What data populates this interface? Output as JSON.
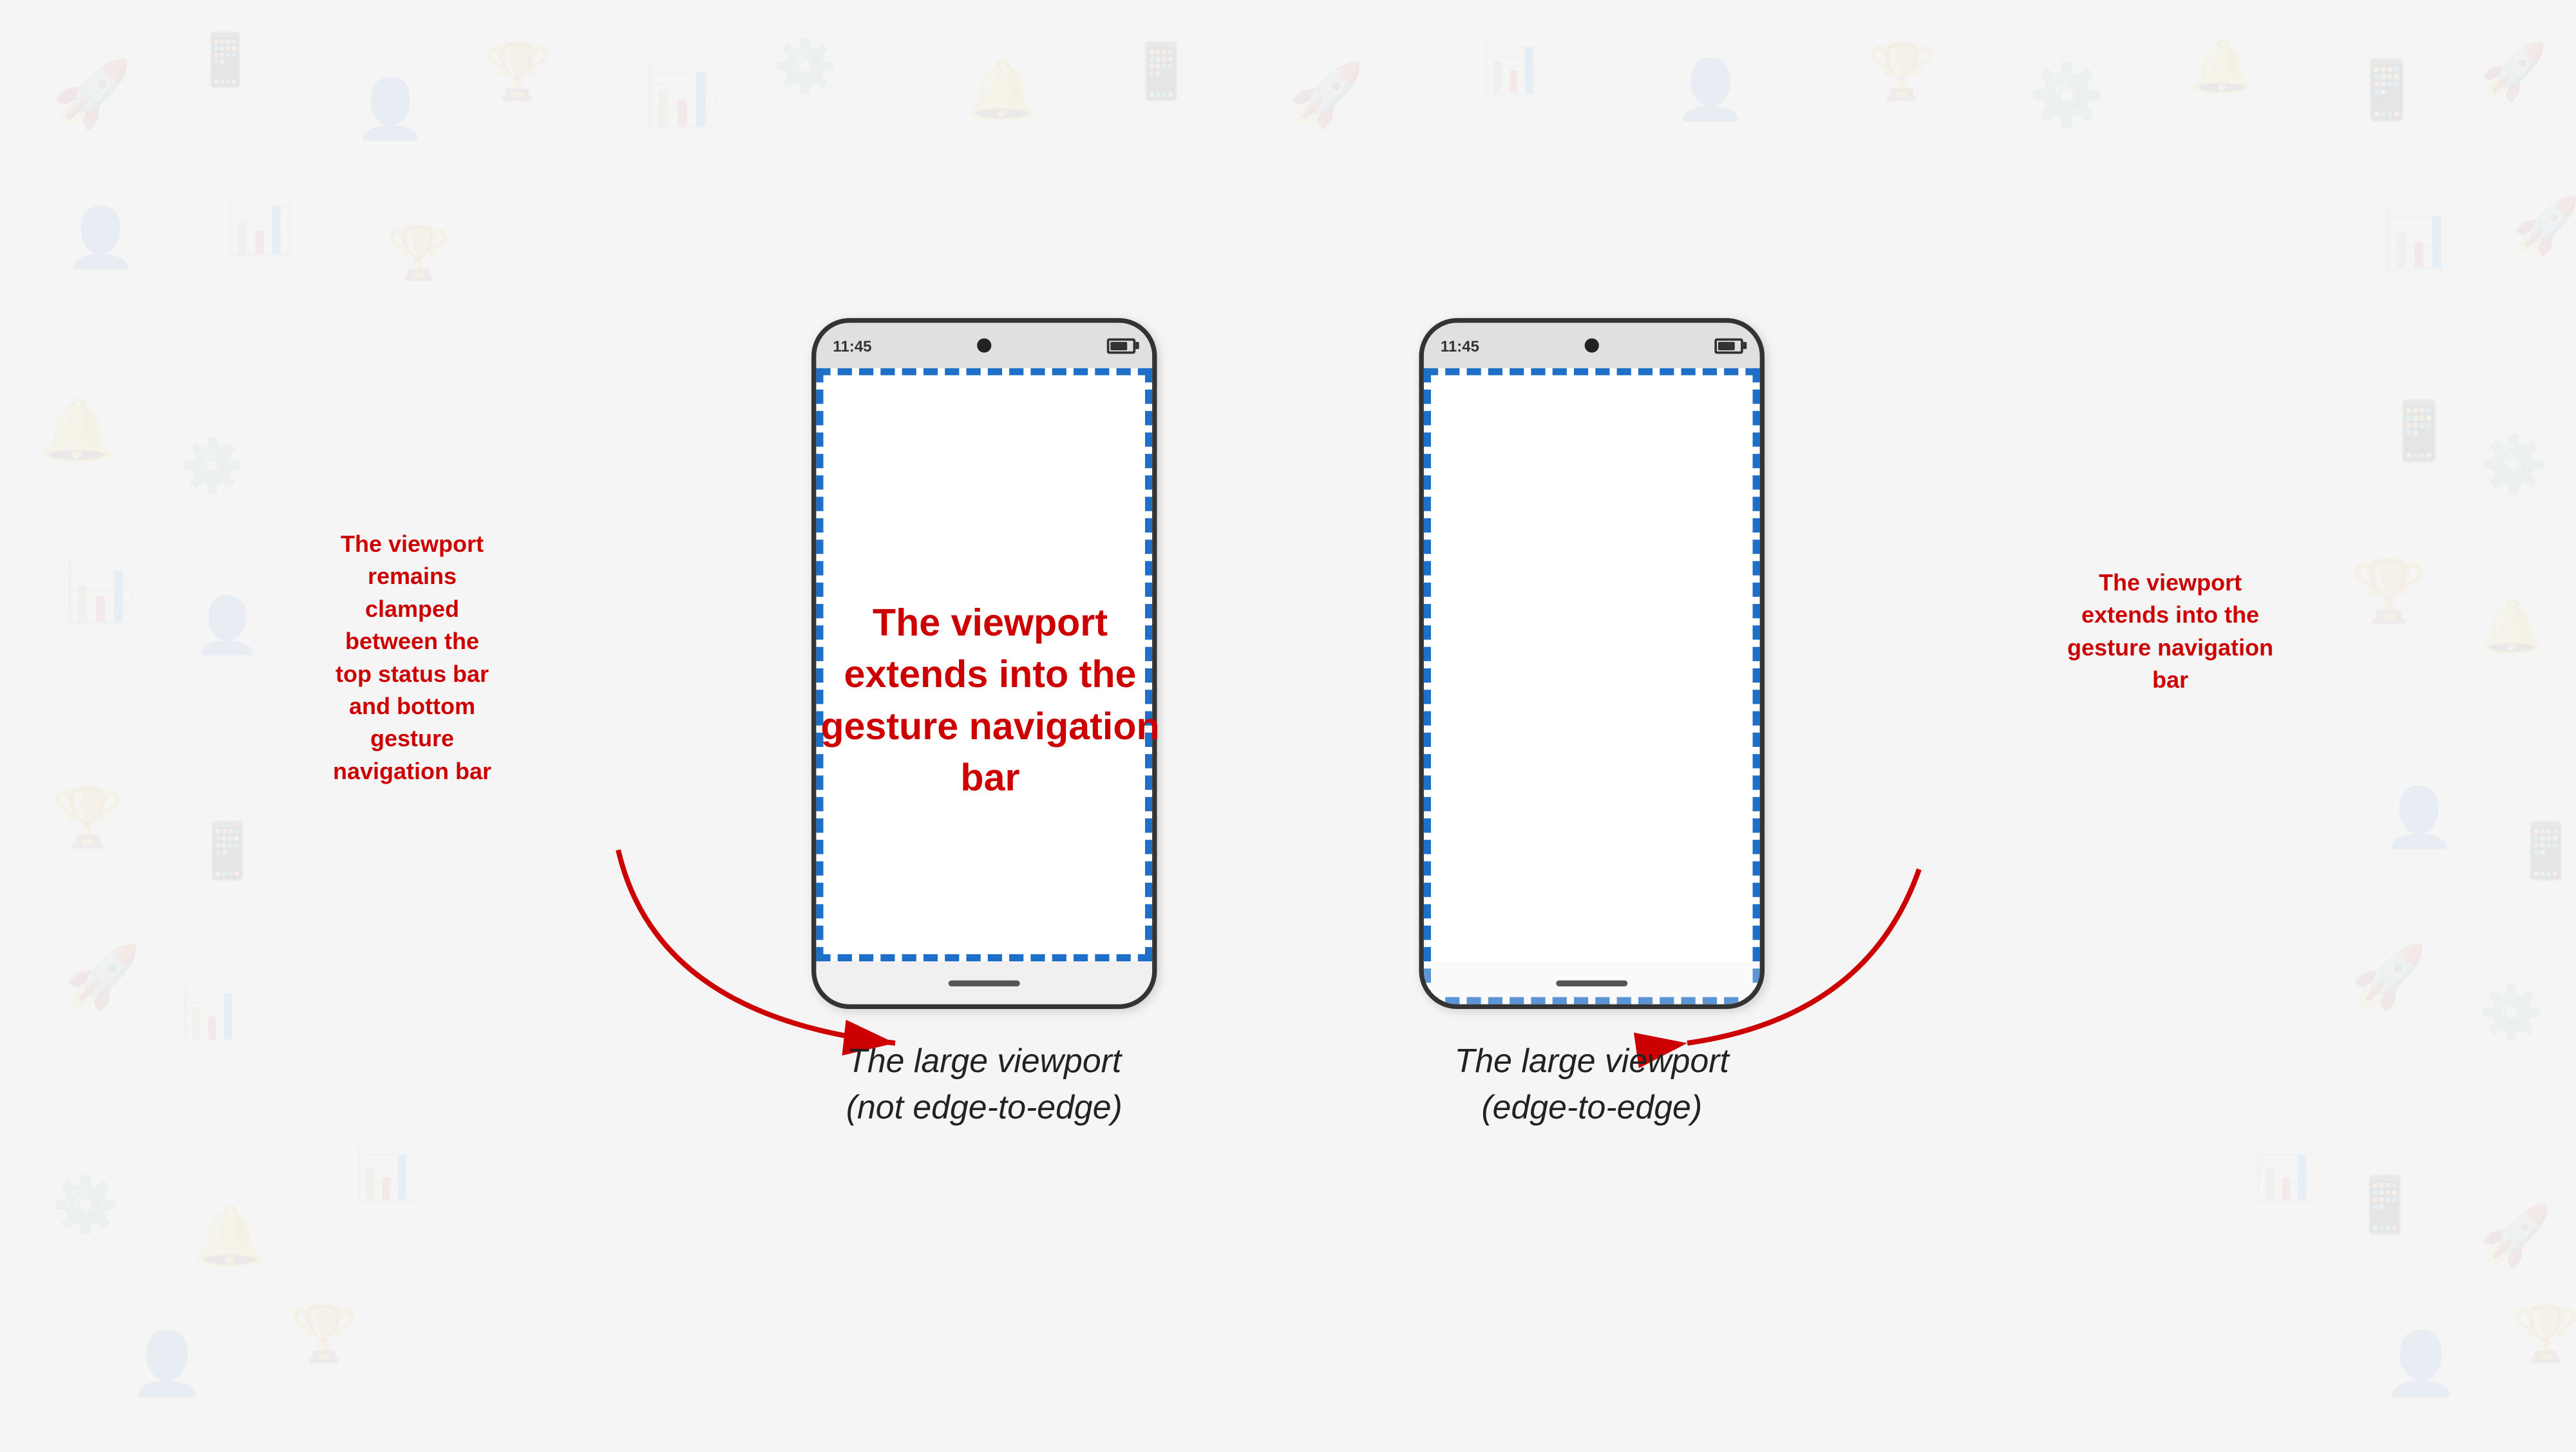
{
  "background": {
    "color": "#f5f5f5"
  },
  "phone1": {
    "status_time": "11:45",
    "caption_line1": "The large viewport",
    "caption_line2": "(not edge-to-edge)"
  },
  "phone2": {
    "status_time": "11:45",
    "caption_line1": "The large viewport",
    "caption_line2": "(edge-to-edge)"
  },
  "annotation_left": {
    "line1": "The viewport",
    "line2": "remains",
    "line3": "clamped",
    "line4": "between the",
    "line5": "top status bar",
    "line6": "and bottom",
    "line7": "gesture",
    "line8": "navigation bar"
  },
  "annotation_right": {
    "line1": "The viewport",
    "line2": "extends into the",
    "line3": "gesture navigation",
    "line4": "bar"
  },
  "colors": {
    "accent_red": "#cc0000",
    "phone_border": "#333333",
    "dashed_blue": "#1e6fc8",
    "status_bar_bg": "#e0e0e0",
    "gesture_bar_bg": "#f0f0f0"
  }
}
